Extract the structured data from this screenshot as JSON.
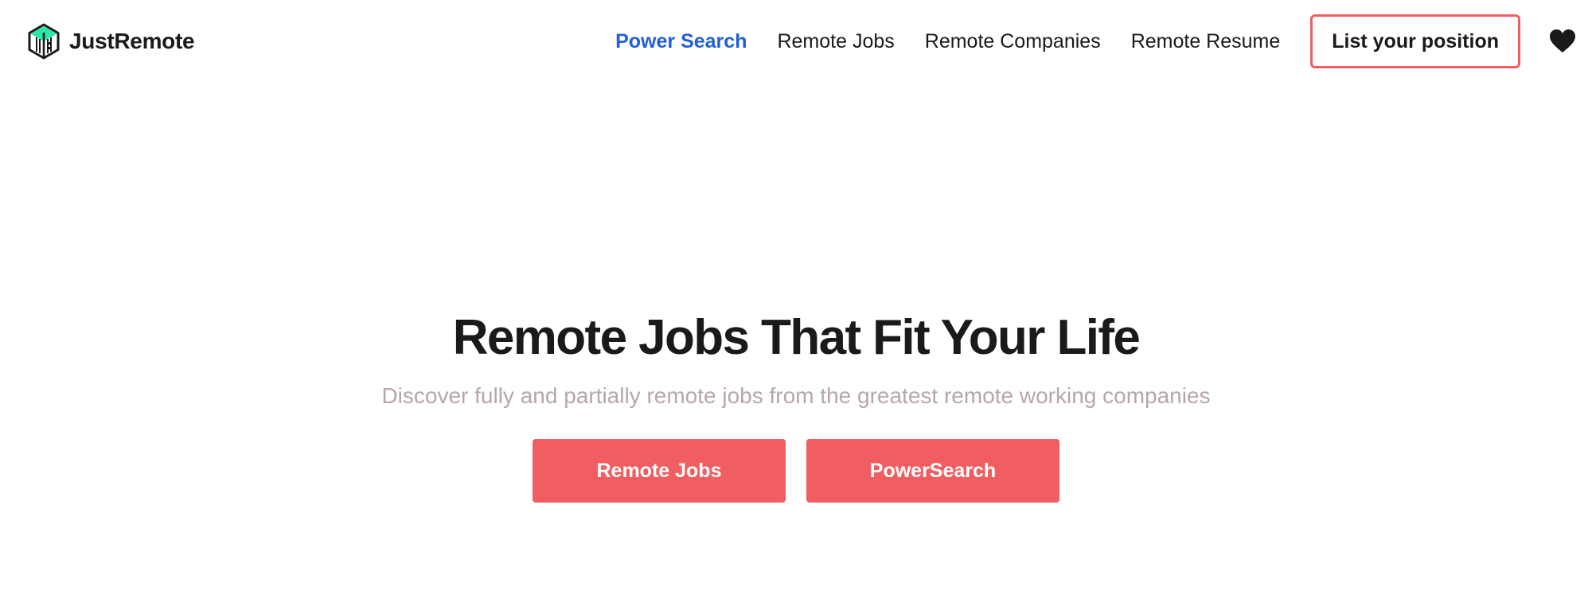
{
  "brand": {
    "name": "JustRemote",
    "logo_icon": "building-hexagon-icon"
  },
  "nav": {
    "links": [
      {
        "label": "Power Search",
        "active": true
      },
      {
        "label": "Remote Jobs",
        "active": false
      },
      {
        "label": "Remote Companies",
        "active": false
      },
      {
        "label": "Remote Resume",
        "active": false
      }
    ],
    "cta_label": "List your position",
    "favorites_icon": "heart-icon"
  },
  "hero": {
    "title": "Remote Jobs That Fit Your Life",
    "subtitle": "Discover fully and partially remote jobs from the greatest remote working companies",
    "buttons": [
      {
        "label": "Remote Jobs"
      },
      {
        "label": "PowerSearch"
      }
    ]
  },
  "colors": {
    "accent": "#f05e61",
    "active_link": "#2260d9",
    "logo_green": "#2ee6a8",
    "subtitle": "#b7a6ad",
    "text": "#1a1a1a"
  }
}
